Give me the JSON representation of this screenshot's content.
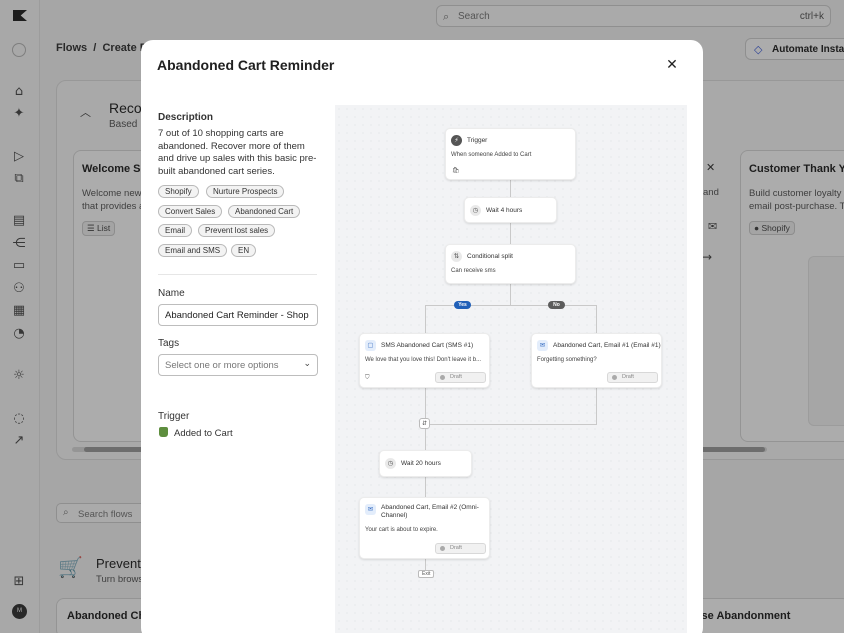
{
  "app": {
    "search_placeholder": "Search",
    "search_shortcut": "ctrl+k",
    "breadcrumb": [
      "Flows",
      "Create Fl"
    ],
    "automate_button": "Automate Instagra",
    "recommended_title": "Recon",
    "recommended_sub": "Based",
    "cards": [
      {
        "title": "Welcome Se",
        "desc": "Welcome new\nthat provides a",
        "tag": "List"
      },
      {
        "title": "Customer Thank You",
        "desc": "Build customer loyalty b\nemail post-purchase. Th",
        "tag": "Shopify"
      }
    ],
    "card_partial_text": "and",
    "search_flows_placeholder": "Search flows",
    "prevent_title": "Prevent",
    "prevent_sub": "Turn brows",
    "bottom_cards": [
      "Abandoned Che",
      "wse Abandonment"
    ],
    "avatar_initials": "M"
  },
  "modal": {
    "title": "Abandoned Cart Reminder",
    "description_label": "Description",
    "description": "7 out of 10 shopping carts are abandoned. Recover more of them and drive up sales with this basic pre-built abandoned cart series.",
    "tags": [
      "Shopify",
      "Nurture Prospects",
      "Convert Sales",
      "Abandoned Cart",
      "Email",
      "Prevent lost sales",
      "Email and SMS",
      "EN"
    ],
    "name_label": "Name",
    "name_value": "Abandoned Cart Reminder - Shop",
    "tags_label": "Tags",
    "tags_placeholder": "Select one or more options",
    "trigger_label": "Trigger",
    "trigger_value": "Added to Cart"
  },
  "flow": {
    "trigger_title": "Trigger",
    "trigger_sub": "When someone Added to Cart",
    "wait1": "Wait 4 hours",
    "split_title": "Conditional split",
    "split_sub": "Can receive sms",
    "yes_label": "Yes",
    "no_label": "No",
    "sms_title": "SMS Abandoned Cart (SMS #1)",
    "sms_sub": "We love that you love this! Don't leave it b...",
    "email1_title": "Abandoned Cart, Email #1 (Email #1)",
    "email1_sub": "Forgetting something?",
    "wait2": "Wait 20 hours",
    "email2_title_1": "Abandoned Cart, Email #2 (Omni-",
    "email2_title_2": "Channel)",
    "email2_sub": "Your cart is about to expire.",
    "draft_label": "Draft",
    "exit_label": "Exit",
    "colors": {
      "yes": "#1f5fb8",
      "no": "#5c5c5c"
    }
  }
}
